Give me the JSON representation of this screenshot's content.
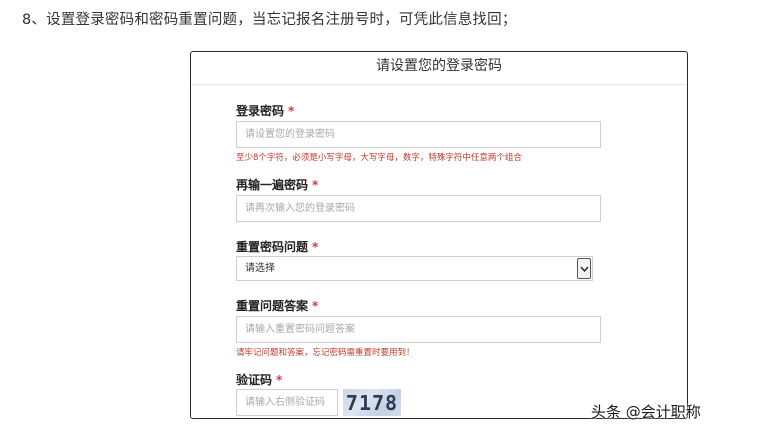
{
  "step_text": "8、设置登录密码和密码重置问题，当忘记报名注册号时，可凭此信息找回；",
  "form": {
    "title": "请设置您的登录密码",
    "password": {
      "label": "登录密码",
      "required_mark": "*",
      "placeholder": "请设置您的登录密码",
      "hint": "至少8个字符，必须是小写字母，大写字母，数字，特殊字符中任意两个组合"
    },
    "confirm_password": {
      "label": "再输一遍密码",
      "required_mark": "*",
      "placeholder": "请再次输入您的登录密码"
    },
    "reset_question": {
      "label": "重置密码问题",
      "required_mark": "*",
      "selected": "请选择"
    },
    "reset_answer": {
      "label": "重置问题答案",
      "required_mark": "*",
      "placeholder": "请输入重置密码问题答案",
      "hint": "请牢记问题和答案，忘记密码需重置时要用到！"
    },
    "captcha": {
      "label": "验证码",
      "required_mark": "*",
      "placeholder": "请输入右侧验证码",
      "image_text": "7178"
    }
  },
  "watermark": {
    "text": "头条 @会计职称"
  },
  "colors": {
    "required": "#d9363e",
    "hint": "#c0392b",
    "border": "#cfcfcf"
  }
}
